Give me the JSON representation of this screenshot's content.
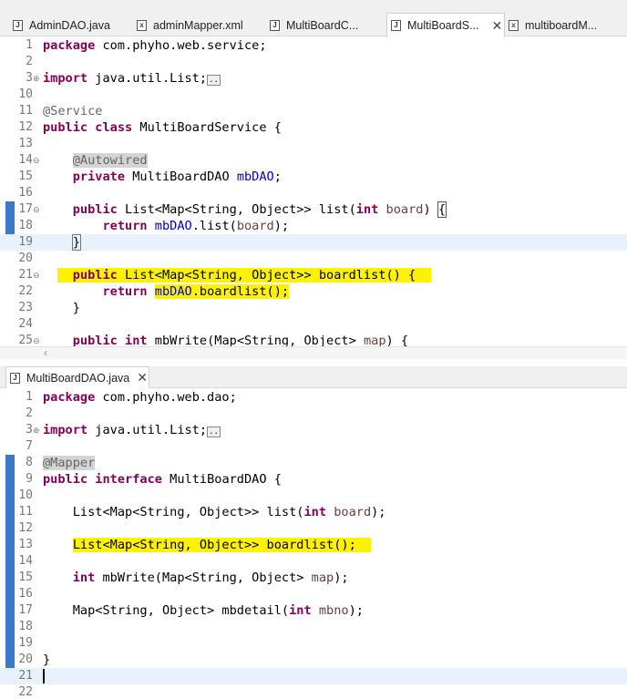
{
  "top_tabs": [
    {
      "label": "AdminDAO.java",
      "icon": "java-file-icon",
      "active": false
    },
    {
      "label": "adminMapper.xml",
      "icon": "xml-file-icon",
      "active": false
    },
    {
      "label": "MultiBoardC...",
      "icon": "java-file-icon",
      "active": false
    },
    {
      "label": "MultiBoardS...",
      "icon": "java-file-icon",
      "active": true
    },
    {
      "label": "multiboardM...",
      "icon": "xml-file-icon",
      "active": false
    }
  ],
  "bottom_tab": {
    "label": "MultiBoardDAO.java",
    "icon": "java-file-icon"
  },
  "icons": {
    "java_glyph": "J",
    "xml_glyph": "x",
    "close_glyph": "✕",
    "fold_open": "⊖",
    "fold_closed": "⊕",
    "scroll_left": "‹"
  },
  "colors": {
    "highlight": "#fff200",
    "keyword": "#7f0055",
    "field": "#0000c0",
    "param": "#6a3e3e"
  },
  "service_lines": [
    {
      "n": "1",
      "c": "package com.phyho.web.service;"
    },
    {
      "n": "2",
      "c": ""
    },
    {
      "n": "3",
      "c": "import java.util.List;"
    },
    {
      "n": "10",
      "c": ""
    },
    {
      "n": "11",
      "c": "@Service"
    },
    {
      "n": "12",
      "c": "public class MultiBoardService {"
    },
    {
      "n": "13",
      "c": ""
    },
    {
      "n": "14",
      "c": "    @Autowired"
    },
    {
      "n": "15",
      "c": "    private MultiBoardDAO mbDAO;"
    },
    {
      "n": "16",
      "c": ""
    },
    {
      "n": "17",
      "c": "    public List<Map<String, Object>> list(int board) {"
    },
    {
      "n": "18",
      "c": "        return mbDAO.list(board);"
    },
    {
      "n": "19",
      "c": "    }"
    },
    {
      "n": "20",
      "c": ""
    },
    {
      "n": "21",
      "c": "    public List<Map<String, Object>> boardlist() {"
    },
    {
      "n": "22",
      "c": "        return mbDAO.boardlist();"
    },
    {
      "n": "23",
      "c": "    }"
    },
    {
      "n": "24",
      "c": ""
    },
    {
      "n": "25",
      "c": "    public int mbWrite(Map<String, Object> map) {"
    }
  ],
  "dao_lines": [
    {
      "n": "1",
      "c": "package com.phyho.web.dao;"
    },
    {
      "n": "2",
      "c": ""
    },
    {
      "n": "3",
      "c": "import java.util.List;"
    },
    {
      "n": "7",
      "c": ""
    },
    {
      "n": "8",
      "c": "@Mapper"
    },
    {
      "n": "9",
      "c": "public interface MultiBoardDAO {"
    },
    {
      "n": "10",
      "c": ""
    },
    {
      "n": "11",
      "c": "    List<Map<String, Object>> list(int board);"
    },
    {
      "n": "12",
      "c": ""
    },
    {
      "n": "13",
      "c": "    List<Map<String, Object>> boardlist();"
    },
    {
      "n": "14",
      "c": ""
    },
    {
      "n": "15",
      "c": "    int mbWrite(Map<String, Object> map);"
    },
    {
      "n": "16",
      "c": ""
    },
    {
      "n": "17",
      "c": "    Map<String, Object> mbdetail(int mbno);"
    },
    {
      "n": "18",
      "c": ""
    },
    {
      "n": "19",
      "c": ""
    },
    {
      "n": "20",
      "c": "}"
    },
    {
      "n": "21",
      "c": ""
    },
    {
      "n": "22",
      "c": ""
    }
  ]
}
